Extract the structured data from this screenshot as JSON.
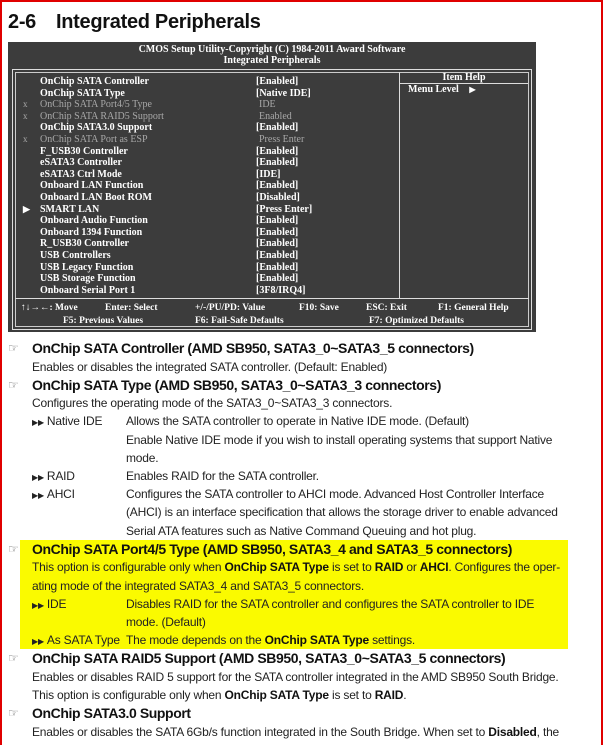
{
  "page": {
    "section_number": "2-6",
    "section_title": "Integrated Peripherals",
    "highlight_color": "#fafa00",
    "border_color": "#e00000"
  },
  "bios": {
    "header_line1": "CMOS Setup Utility-Copyright (C) 1984-2011 Award Software",
    "header_line2": "Integrated Peripherals",
    "items": [
      {
        "marker": "",
        "label": "OnChip SATA Controller",
        "value": "[Enabled]",
        "disabled": false
      },
      {
        "marker": "",
        "label": "OnChip SATA Type",
        "value": "[Native IDE]",
        "disabled": false
      },
      {
        "marker": "x",
        "label": "OnChip SATA Port4/5 Type",
        "value": "IDE",
        "disabled": true
      },
      {
        "marker": "x",
        "label": "OnChip SATA RAID5 Support",
        "value": "Enabled",
        "disabled": true
      },
      {
        "marker": "",
        "label": "OnChip SATA3.0 Support",
        "value": "[Enabled]",
        "disabled": false
      },
      {
        "marker": "x",
        "label": "OnChip SATA Port as ESP",
        "value": "Press Enter",
        "disabled": true
      },
      {
        "marker": "",
        "label": "F_USB30 Controller",
        "value": "[Enabled]",
        "disabled": false
      },
      {
        "marker": "",
        "label": "eSATA3 Controller",
        "value": "[Enabled]",
        "disabled": false
      },
      {
        "marker": "",
        "label": "eSATA3 Ctrl Mode",
        "value": "[IDE]",
        "disabled": false
      },
      {
        "marker": "",
        "label": "Onboard LAN Function",
        "value": "[Enabled]",
        "disabled": false
      },
      {
        "marker": "",
        "label": "Onboard LAN Boot ROM",
        "value": "[Disabled]",
        "disabled": false
      },
      {
        "marker": "▶",
        "label": "SMART LAN",
        "value": "[Press Enter]",
        "disabled": false
      },
      {
        "marker": "",
        "label": "Onboard Audio Function",
        "value": "[Enabled]",
        "disabled": false
      },
      {
        "marker": "",
        "label": "Onboard 1394 Function",
        "value": "[Enabled]",
        "disabled": false
      },
      {
        "marker": "",
        "label": "R_USB30 Controller",
        "value": "[Enabled]",
        "disabled": false
      },
      {
        "marker": "",
        "label": "USB Controllers",
        "value": "[Enabled]",
        "disabled": false
      },
      {
        "marker": "",
        "label": "USB Legacy Function",
        "value": "[Enabled]",
        "disabled": false
      },
      {
        "marker": "",
        "label": "USB Storage Function",
        "value": "[Enabled]",
        "disabled": false
      },
      {
        "marker": "",
        "label": "Onboard Serial Port 1",
        "value": "[3F8/IRQ4]",
        "disabled": false
      }
    ],
    "help_title": "Item Help",
    "menu_level": "Menu Level",
    "menu_level_icon": "triangle-right",
    "footer": [
      "↑↓→←: Move",
      "Enter: Select",
      "+/-/PU/PD: Value",
      "F10: Save",
      "ESC: Exit",
      "F1: General Help",
      "F5: Previous Values",
      "F6: Fail-Safe Defaults",
      "F7: Optimized Defaults"
    ]
  },
  "sections": [
    {
      "heading": "OnChip SATA Controller (AMD SB950, SATA3_0~SATA3_5 connectors)",
      "highlighted": false,
      "lines": [
        [
          {
            "t": "Enables or disables the integrated SATA controller. (Default: Enabled)"
          }
        ]
      ],
      "options": []
    },
    {
      "heading": "OnChip SATA Type (AMD SB950, SATA3_0~SATA3_3 connectors)",
      "highlighted": false,
      "lines": [
        [
          {
            "t": "Configures the operating mode of the SATA3_0~SATA3_3 connectors."
          }
        ]
      ],
      "options": [
        {
          "name": "Native IDE",
          "lines": [
            [
              {
                "t": "Allows the SATA controller to operate in Native IDE mode. (Default)"
              }
            ],
            [
              {
                "t": "Enable Native IDE mode if you wish to install operating systems that support Native"
              }
            ],
            [
              {
                "t": "mode."
              }
            ]
          ]
        },
        {
          "name": "RAID",
          "lines": [
            [
              {
                "t": "Enables RAID for the SATA controller."
              }
            ]
          ]
        },
        {
          "name": "AHCI",
          "lines": [
            [
              {
                "t": "Configures the SATA controller to AHCI mode. Advanced Host Controller Interface"
              }
            ],
            [
              {
                "t": "(AHCI) is an interface specification that allows the storage driver to enable advanced"
              }
            ],
            [
              {
                "t": "Serial ATA features such as Native Command Queuing and hot plug."
              }
            ]
          ]
        }
      ]
    },
    {
      "heading": "OnChip SATA Port4/5 Type (AMD SB950, SATA3_4 and SATA3_5 connectors)",
      "highlighted": true,
      "lines": [
        [
          {
            "t": "This option is configurable only when "
          },
          {
            "t": "OnChip SATA Type",
            "b": true
          },
          {
            "t": " is set to "
          },
          {
            "t": "RAID",
            "b": true
          },
          {
            "t": " or "
          },
          {
            "t": "AHCI",
            "b": true
          },
          {
            "t": ". Configures the oper-"
          }
        ],
        [
          {
            "t": "ating mode of the integrated SATA3_4 and SATA3_5 connectors."
          }
        ]
      ],
      "options": [
        {
          "name": "IDE",
          "lines": [
            [
              {
                "t": "Disables RAID for the SATA controller and configures the SATA controller to IDE"
              }
            ],
            [
              {
                "t": "mode. (Default)"
              }
            ]
          ]
        },
        {
          "name": "As SATA Type",
          "lines": [
            [
              {
                "t": "The mode depends on the "
              },
              {
                "t": "OnChip SATA Type",
                "b": true
              },
              {
                "t": " settings."
              }
            ]
          ]
        }
      ]
    },
    {
      "heading": "OnChip SATA RAID5 Support (AMD SB950, SATA3_0~SATA3_5 connectors)",
      "highlighted": false,
      "lines": [
        [
          {
            "t": "Enables or disables RAID 5 support for the SATA controller integrated in the AMD SB950 South Bridge."
          }
        ],
        [
          {
            "t": "This option is configurable only when "
          },
          {
            "t": "OnChip SATA Type",
            "b": true
          },
          {
            "t": " is set to "
          },
          {
            "t": "RAID",
            "b": true
          },
          {
            "t": "."
          }
        ]
      ],
      "options": []
    },
    {
      "heading": "OnChip SATA3.0 Support",
      "highlighted": false,
      "lines": [
        [
          {
            "t": "Enables or disables the SATA 6Gb/s function integrated in the South Bridge. When set to "
          },
          {
            "t": "Disabled",
            "b": true
          },
          {
            "t": ", the"
          }
        ]
      ],
      "options": []
    }
  ]
}
